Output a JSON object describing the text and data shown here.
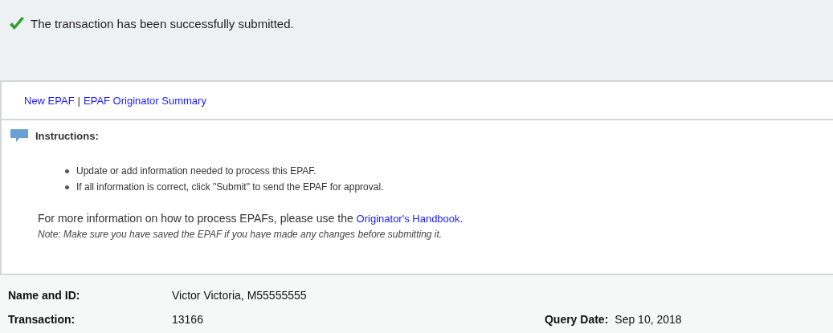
{
  "message": {
    "text": "The transaction has been successfully submitted."
  },
  "nav_links": [
    {
      "label": "New EPAF"
    },
    {
      "label": "EPAF Originator Summary"
    }
  ],
  "nav_separator": "|",
  "instructions": {
    "title": "Instructions:",
    "bullets": [
      "Update or add information needed to process this EPAF.",
      "If all information is correct, click \"Submit\" to send the EPAF for approval."
    ],
    "more_info": "For more information on how to process EPAFs, please use the",
    "handbook_link": "Originator's Handbook",
    "after_link": ".",
    "note": "Note: Make sure you have saved the EPAF if you have made any changes before submitting it."
  },
  "details": [
    {
      "label": "Name and ID:",
      "value": "Victor Victoria, M55555555"
    },
    {
      "label": "Transaction:",
      "value": "13166",
      "extra_label": "Query Date:",
      "extra_value": "Sep 10, 2018"
    }
  ]
}
